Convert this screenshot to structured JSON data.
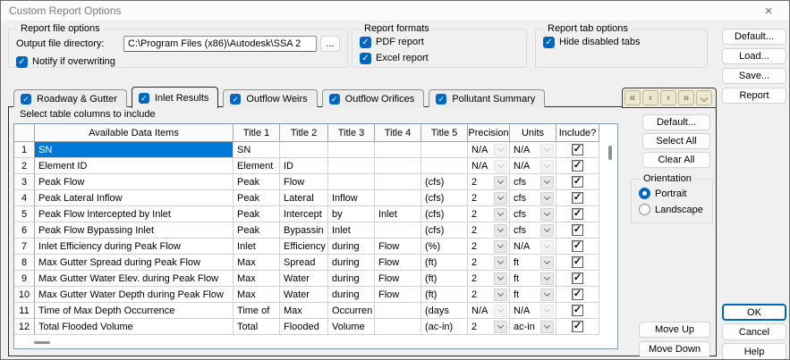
{
  "window": {
    "title": "Custom Report Options",
    "close_glyph": "×"
  },
  "icons": {
    "check": "✓"
  },
  "colors": {
    "accent_checkbox": "#0067c0",
    "selection": "#0078d7",
    "nav_beige": "#ece8cf"
  },
  "report_file_options": {
    "legend": "Report file options",
    "output_dir_label": "Output file directory:",
    "output_dir_value": "C:\\Program Files (x86)\\Autodesk\\SSA 2",
    "browse_label": "...",
    "notify_label": "Notify if overwriting",
    "notify_checked": true
  },
  "report_formats": {
    "legend": "Report formats",
    "items": [
      {
        "label": "PDF report",
        "checked": true
      },
      {
        "label": "Excel report",
        "checked": true
      }
    ]
  },
  "report_tab_options": {
    "legend": "Report tab options",
    "items": [
      {
        "label": "Hide disabled tabs",
        "checked": true
      }
    ]
  },
  "side_buttons": [
    "Default...",
    "Load...",
    "Save...",
    "Report"
  ],
  "tabs": [
    {
      "label": "Roadway & Gutter",
      "checked": true,
      "active": false
    },
    {
      "label": "Inlet Results",
      "checked": true,
      "active": true
    },
    {
      "label": "Outflow Weirs",
      "checked": true,
      "active": false
    },
    {
      "label": "Outflow Orifices",
      "checked": true,
      "active": false
    },
    {
      "label": "Pollutant Summary",
      "checked": true,
      "active": false
    }
  ],
  "nav_buttons": [
    {
      "name": "first",
      "glyph": "«"
    },
    {
      "name": "previous",
      "glyph": "‹"
    },
    {
      "name": "next",
      "glyph": "›"
    },
    {
      "name": "last",
      "glyph": "»"
    },
    {
      "name": "more",
      "glyph": ""
    }
  ],
  "table": {
    "caption": "Select table columns to include",
    "headers": [
      "",
      "Available Data Items",
      "Title 1",
      "Title 2",
      "Title 3",
      "Title 4",
      "Title 5",
      "Precision",
      "Units",
      "Include?"
    ],
    "rows": [
      {
        "n": "1",
        "item": "SN",
        "selected": true,
        "titles": [
          "SN",
          "",
          "",
          "",
          ""
        ],
        "precision": {
          "value": "N/A",
          "enabled": false
        },
        "units": {
          "value": "N/A",
          "enabled": false
        },
        "include": true
      },
      {
        "n": "2",
        "item": "Element ID",
        "titles": [
          "Element",
          "ID",
          "",
          "",
          ""
        ],
        "precision": {
          "value": "N/A",
          "enabled": false
        },
        "units": {
          "value": "N/A",
          "enabled": false
        },
        "include": true
      },
      {
        "n": "3",
        "item": "Peak Flow",
        "titles": [
          "Peak",
          "Flow",
          "",
          "",
          "(cfs)"
        ],
        "precision": {
          "value": "2",
          "enabled": true
        },
        "units": {
          "value": "cfs",
          "enabled": true
        },
        "include": true
      },
      {
        "n": "4",
        "item": "Peak Lateral Inflow",
        "titles": [
          "Peak",
          "Lateral",
          "Inflow",
          "",
          "(cfs)"
        ],
        "precision": {
          "value": "2",
          "enabled": true
        },
        "units": {
          "value": "cfs",
          "enabled": true
        },
        "include": true
      },
      {
        "n": "5",
        "item": "Peak Flow Intercepted by Inlet",
        "titles": [
          "Peak",
          "Intercept",
          "by",
          "Inlet",
          "(cfs)"
        ],
        "precision": {
          "value": "2",
          "enabled": true
        },
        "units": {
          "value": "cfs",
          "enabled": true
        },
        "include": true
      },
      {
        "n": "6",
        "item": "Peak Flow Bypassing Inlet",
        "titles": [
          "Peak",
          "Bypassin",
          "Inlet",
          "",
          "(cfs)"
        ],
        "precision": {
          "value": "2",
          "enabled": true
        },
        "units": {
          "value": "cfs",
          "enabled": true
        },
        "include": true
      },
      {
        "n": "7",
        "item": "Inlet Efficiency during Peak Flow",
        "titles": [
          "Inlet",
          "Efficiency",
          "during",
          "Flow",
          "(%)"
        ],
        "precision": {
          "value": "2",
          "enabled": true
        },
        "units": {
          "value": "N/A",
          "enabled": false
        },
        "include": true
      },
      {
        "n": "8",
        "item": "Max Gutter Spread during Peak Flow",
        "titles": [
          "Max",
          "Spread",
          "during",
          "Flow",
          "(ft)"
        ],
        "precision": {
          "value": "2",
          "enabled": true
        },
        "units": {
          "value": "ft",
          "enabled": true
        },
        "include": true
      },
      {
        "n": "9",
        "item": "Max Gutter Water Elev. during Peak Flow",
        "titles": [
          "Max",
          "Water",
          "during",
          "Flow",
          "(ft)"
        ],
        "precision": {
          "value": "2",
          "enabled": true
        },
        "units": {
          "value": "ft",
          "enabled": true
        },
        "include": true
      },
      {
        "n": "10",
        "item": "Max Gutter Water Depth during Peak Flow",
        "titles": [
          "Max",
          "Water",
          "during",
          "Flow",
          "(ft)"
        ],
        "precision": {
          "value": "2",
          "enabled": true
        },
        "units": {
          "value": "ft",
          "enabled": true
        },
        "include": true
      },
      {
        "n": "11",
        "item": "Time of Max Depth Occurrence",
        "titles": [
          "Time of",
          "Max",
          "Occurren",
          "",
          "(days"
        ],
        "precision": {
          "value": "N/A",
          "enabled": false
        },
        "units": {
          "value": "N/A",
          "enabled": false
        },
        "include": true
      },
      {
        "n": "12",
        "item": "Total Flooded Volume",
        "titles": [
          "Total",
          "Flooded",
          "Volume",
          "",
          "(ac-in)"
        ],
        "precision": {
          "value": "2",
          "enabled": true
        },
        "units": {
          "value": "ac-in",
          "enabled": true
        },
        "include": true
      }
    ]
  },
  "panel_buttons": [
    "Default...",
    "Select All",
    "Clear All"
  ],
  "orientation": {
    "legend": "Orientation",
    "options": [
      {
        "label": "Portrait",
        "selected": true
      },
      {
        "label": "Landscape",
        "selected": false
      }
    ]
  },
  "move_buttons": [
    "Move Up",
    "Move Down"
  ],
  "dialog_buttons": [
    {
      "label": "OK",
      "focused": true
    },
    {
      "label": "Cancel",
      "focused": false
    },
    {
      "label": "Help",
      "focused": false
    }
  ]
}
